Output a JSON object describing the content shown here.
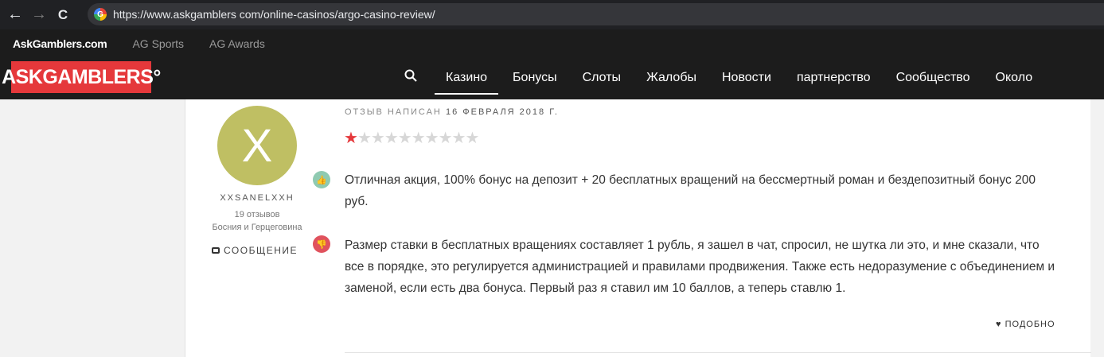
{
  "browser": {
    "url": "https://www.askgamblers com/online-casinos/argo-casino-review/",
    "back": "←",
    "forward": "→",
    "reload": "C"
  },
  "site": {
    "top_links": [
      "AskGamblers.com",
      "AG Sports",
      "AG Awards"
    ],
    "logo": "ASKGAMBLERS°",
    "menu": [
      "Казино",
      "Бонусы",
      "Слоты",
      "Жалобы",
      "Новости",
      "партнерство",
      "Сообщество",
      "Около"
    ],
    "active_menu": "Казино"
  },
  "review": {
    "avatar_letter": "X",
    "username": "XXSANELXXH",
    "count": "19 отзывов",
    "country": "Босния и Герцеговина",
    "message_label": "СООБЩЕНИЕ",
    "date_prefix": "ОТЗЫВ НАПИСАН",
    "date": "16 ФЕВРАЛЯ 2018 Г.",
    "rating": 1,
    "max_rating": 10,
    "pros": "Отличная акция, 100% бонус на депозит + 20 бесплатных вращений на бессмертный роман и бездепозитный бонус 200 руб.",
    "cons": "Размер ставки в бесплатных вращениях составляет 1 рубль, я зашел в чат, спросил, не шутка ли это, и мне сказали, что все в порядке, это регулируется администрацией и правилами продвижения. Также есть недоразумение с объединением и заменой, если есть два бонуса. Первый раз я ставил им 10 баллов, а теперь ставлю 1.",
    "like_label": "ПОДОБНО"
  },
  "colors": {
    "accent": "#e5383b",
    "avatar": "#bfbf63",
    "pro": "#8fcab1",
    "con": "#e0525d"
  }
}
